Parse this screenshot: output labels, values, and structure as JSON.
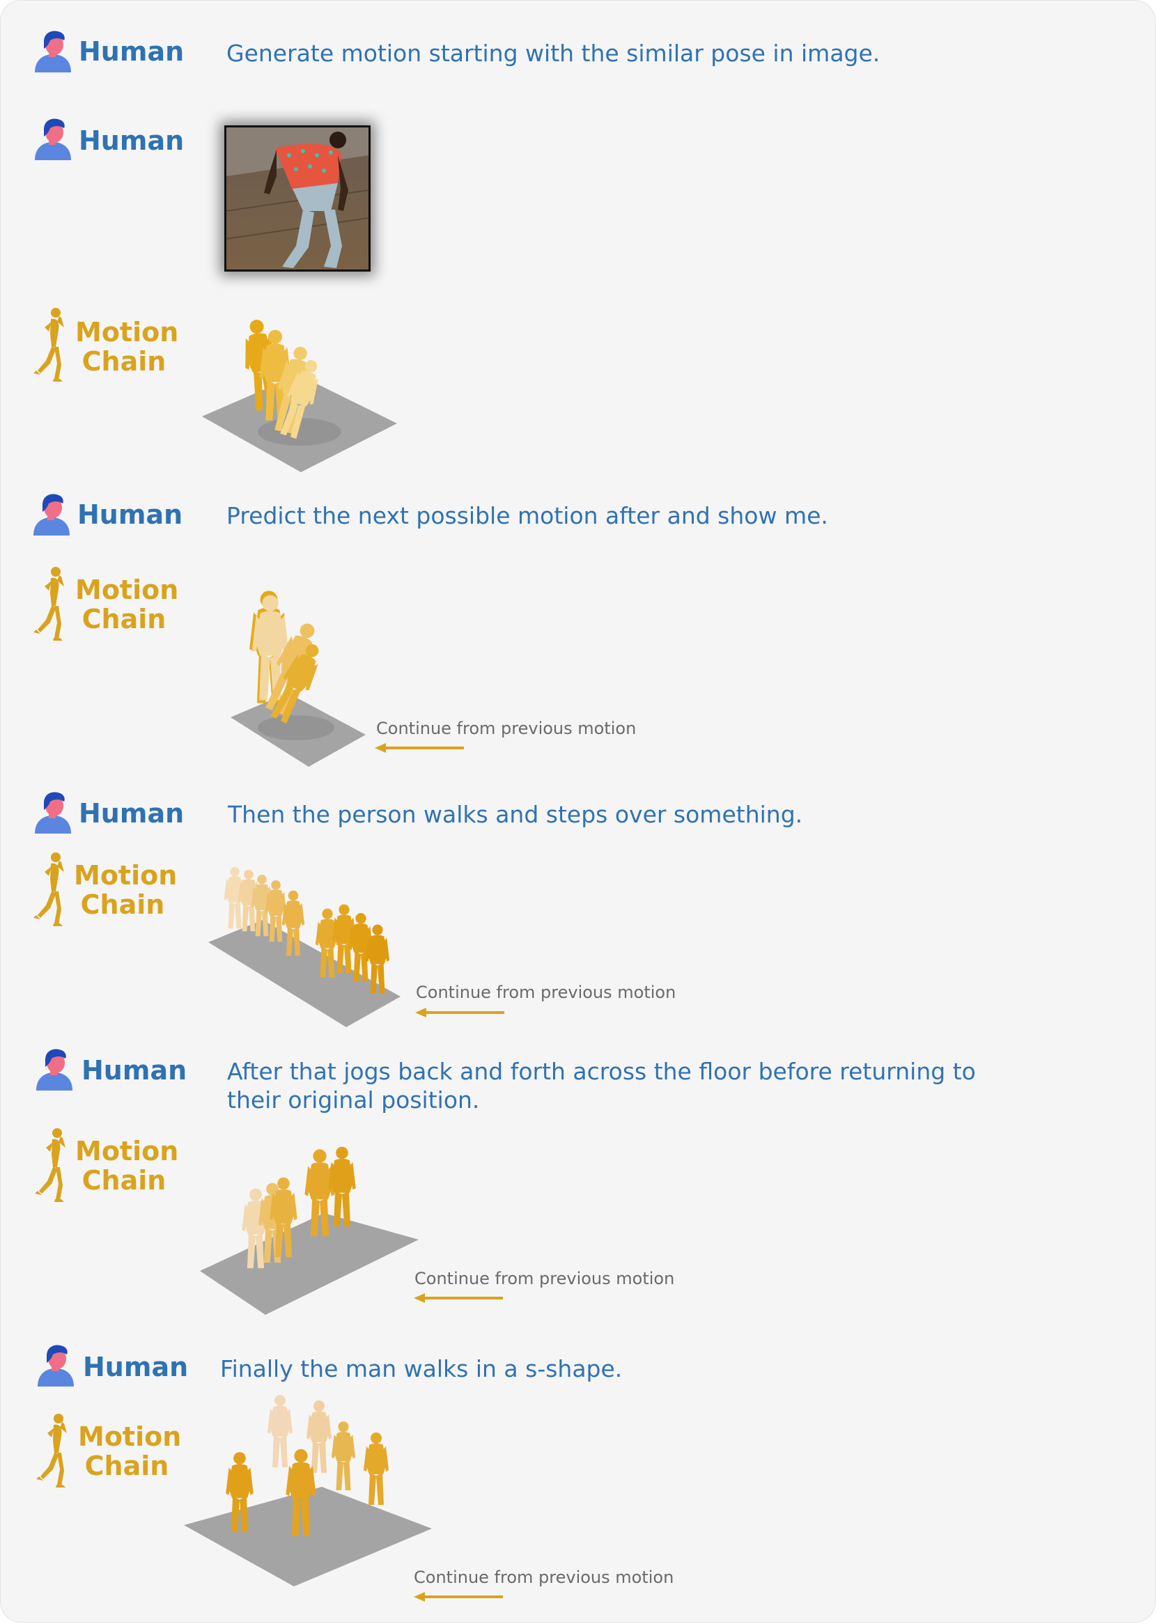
{
  "colors": {
    "human": "#2f72b2",
    "motion": "#d9a31e",
    "floor": "#a4a4a4",
    "panel": "#f5f5f5",
    "note": "#6a6a6a"
  },
  "roles": {
    "human": "Human",
    "motion_line1": "Motion",
    "motion_line2": "Chain"
  },
  "icons": {
    "human": "user-avatar-icon",
    "motion": "motion-figure-icon",
    "arrow": "left-arrow-icon"
  },
  "continue_note": "Continue from previous motion",
  "turns": [
    {
      "role": "human",
      "text": "Generate motion starting with the similar pose in image."
    },
    {
      "role": "human",
      "kind": "image"
    },
    {
      "role": "motion"
    },
    {
      "role": "human",
      "text": "Predict the next possible motion after and show me."
    },
    {
      "role": "motion",
      "note": "Continue from previous motion"
    },
    {
      "role": "human",
      "text": "Then the person walks and steps over something."
    },
    {
      "role": "motion",
      "note": "Continue from previous motion"
    },
    {
      "role": "human",
      "text": "After that jogs back and forth across the floor before returning to their original position."
    },
    {
      "role": "motion",
      "note": "Continue from previous motion"
    },
    {
      "role": "human",
      "text": "Finally the man walks in a s-shape."
    },
    {
      "role": "motion",
      "note": "Continue from previous motion"
    }
  ]
}
